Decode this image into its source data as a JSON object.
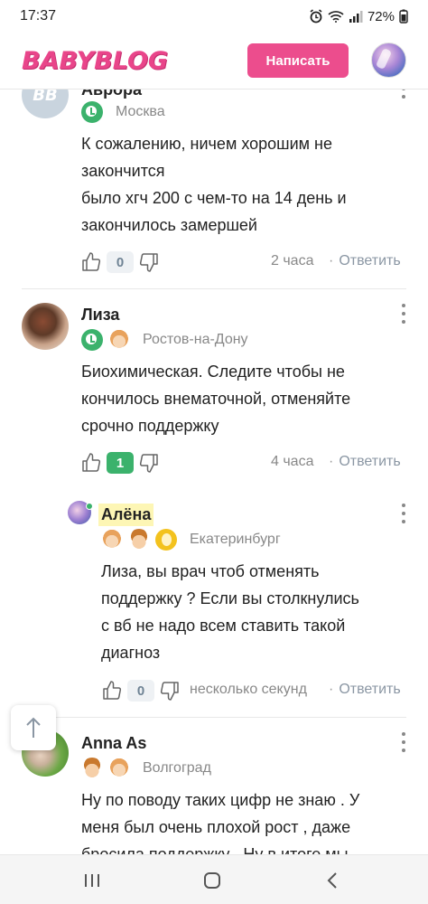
{
  "status_bar": {
    "time": "17:37",
    "battery": "72%"
  },
  "header": {
    "logo": "BABYBLOG",
    "write_button": "Написать"
  },
  "comments": [
    {
      "author": "Аврора",
      "city": "Москва",
      "text_lines": [
        "К сожалению, ничем хорошим не",
        "закончится",
        "было хгч 200 с чем-то на 14 день и",
        "закончилось замершей"
      ],
      "likes": "0",
      "time": "2 часа",
      "reply": "Ответить"
    },
    {
      "author": "Лиза",
      "city": "Ростов-на-Дону",
      "text_lines": [
        "Биохимическая. Следите чтобы не",
        "кончилось внематочной, отменяйте",
        "срочно поддержку"
      ],
      "likes": "1",
      "time": "4 часа",
      "reply": "Ответить"
    },
    {
      "author": "Алёна",
      "city": "Екатеринбург",
      "text_lines": [
        "Лиза, вы врач чтоб отменять",
        "поддержку ? Если вы столкнулись",
        "с вб не надо всем ставить такой",
        "диагноз"
      ],
      "likes": "0",
      "time": "несколько секунд",
      "reply": "Ответить"
    },
    {
      "author": "Anna As",
      "city": "Волгоград",
      "text_lines": [
        "Ну по поводу таких цифр не знаю . У",
        "меня был очень плохой рост , даже",
        "бросила поддержку . Ну в итоге мы"
      ]
    }
  ],
  "colors": {
    "brand": "#ec4d8d",
    "like_positive": "#3bb26c",
    "reply": "#8a96a3"
  }
}
